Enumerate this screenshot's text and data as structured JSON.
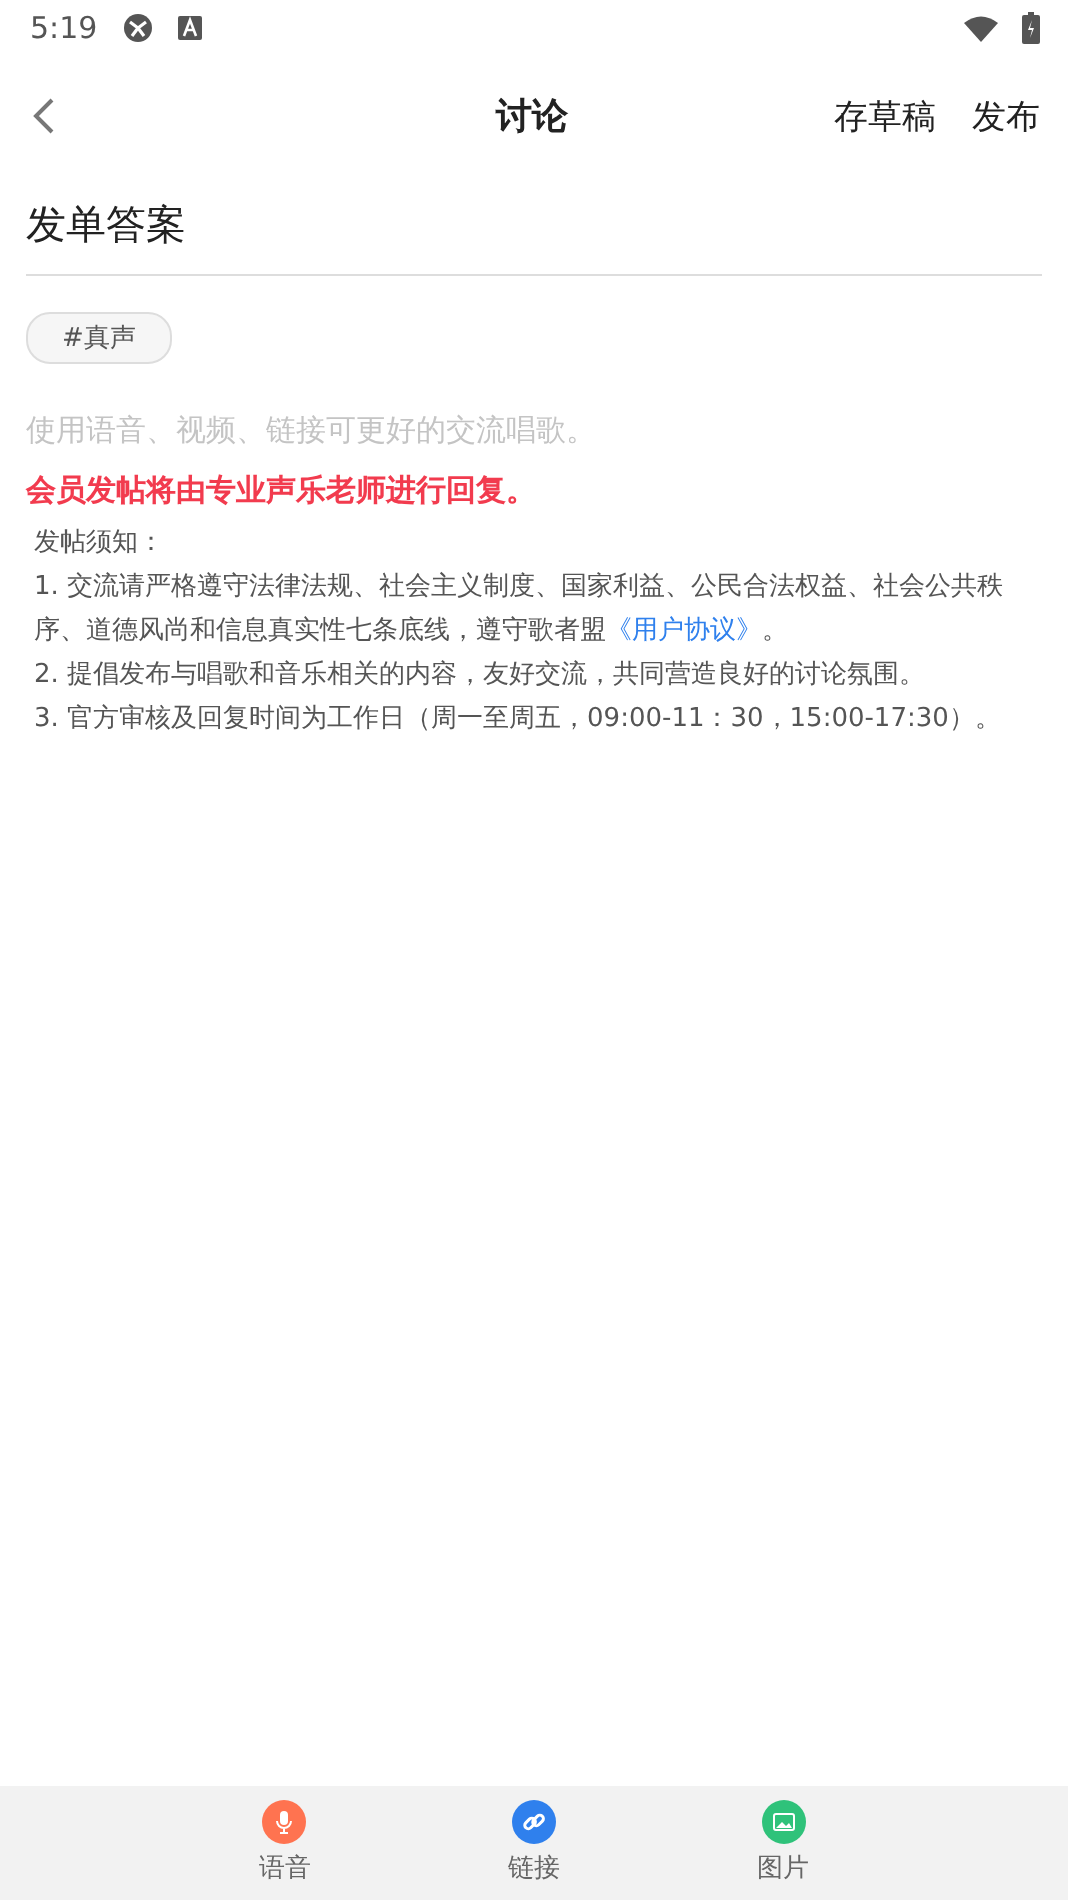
{
  "status_bar": {
    "time": "5:19"
  },
  "header": {
    "title": "讨论",
    "actions": [
      "存草稿",
      "发布"
    ]
  },
  "title_field": {
    "value": "发单答案"
  },
  "tags": [
    "#真声"
  ],
  "body_field": {
    "placeholder": "使用语音、视频、链接可更好的交流唱歌。"
  },
  "member_notice": "会员发帖将由专业声乐老师进行回复。",
  "rules": {
    "heading": "发帖须知：",
    "items": [
      {
        "text": "1. 交流请严格遵守法律法规、社会主义制度、国家利益、公民合法权益、社会公共秩序、道德风尚和信息真实性七条底线，遵守歌者盟",
        "link": "《用户协议》",
        "after": "。"
      },
      {
        "text": "2. 提倡发布与唱歌和音乐相关的内容，友好交流，共同营造良好的讨论氛围。"
      },
      {
        "text": "3. 官方审核及回复时间为工作日（周一至周五，09:00-11：30，15:00-17:30）。"
      }
    ]
  },
  "toolbar": [
    {
      "kind": "voice",
      "label": "语音",
      "color": "#ff7350"
    },
    {
      "kind": "link",
      "label": "链接",
      "color": "#2f80ed"
    },
    {
      "kind": "image",
      "label": "图片",
      "color": "#2fc27a"
    }
  ]
}
